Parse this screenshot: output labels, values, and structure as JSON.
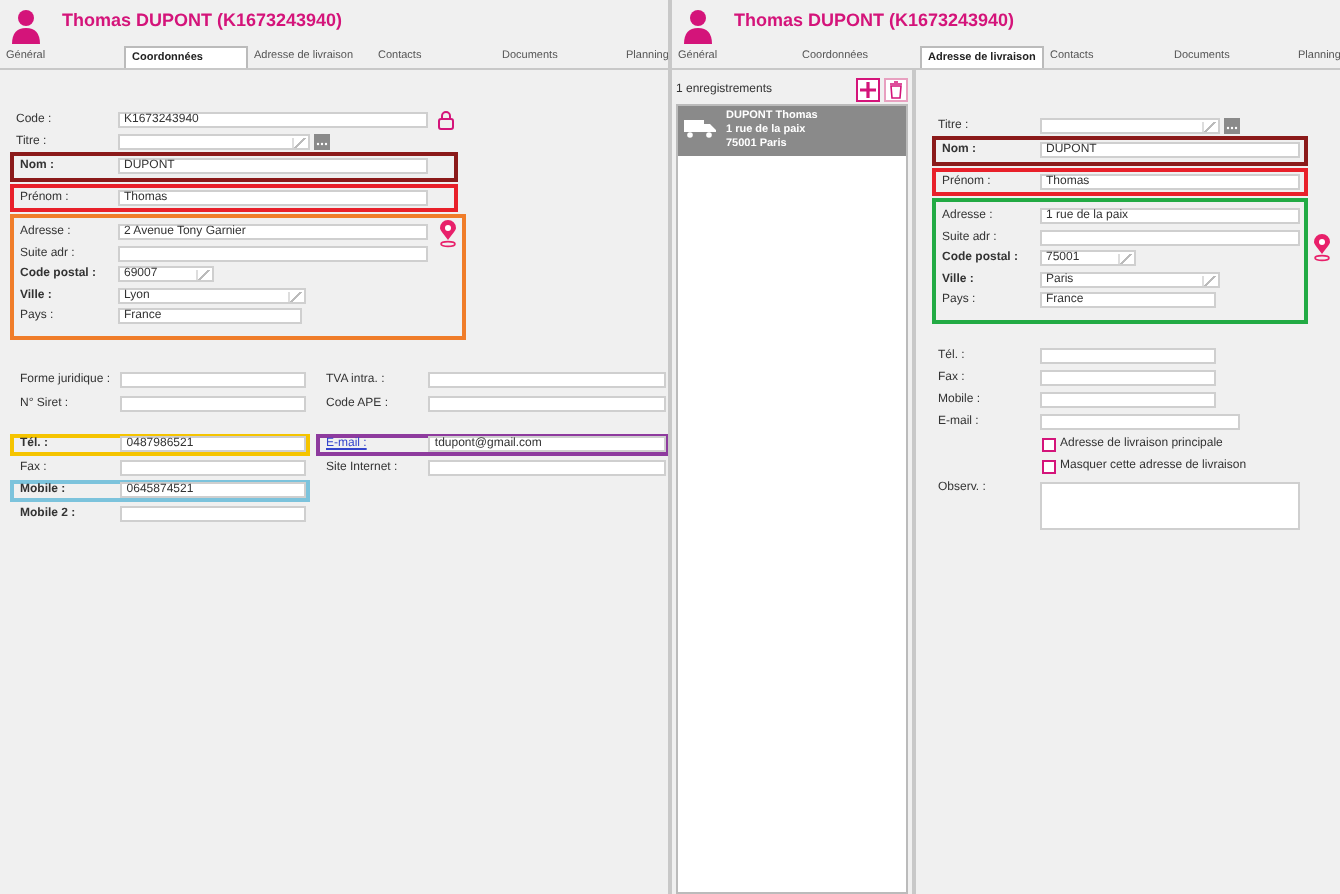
{
  "panels": [
    {
      "title": "Thomas DUPONT (K1673243940)",
      "tabs": [
        {
          "label": "Général",
          "selected": false
        },
        {
          "label": "Coordonnées",
          "selected": true
        },
        {
          "label": "Adresse de livraison",
          "selected": false
        },
        {
          "label": "Contacts",
          "selected": false
        },
        {
          "label": "Documents",
          "selected": false
        },
        {
          "label": "Planning",
          "selected": false
        }
      ],
      "form": [
        {
          "kind": "locked",
          "label": "Code :",
          "value": "K1673243940",
          "bold": false
        },
        {
          "kind": "combomore",
          "label": "Titre :",
          "bold": false
        },
        {
          "kind": "group",
          "color": "#8b1a1a",
          "pin": false,
          "fields": [
            {
              "kind": "input",
              "label": "Nom :",
              "value": "DUPONT",
              "bold": true
            }
          ]
        },
        {
          "kind": "group",
          "color": "#e8202a",
          "pin": false,
          "fields": [
            {
              "kind": "input",
              "label": "Prénom :",
              "value": "Thomas",
              "bold": false
            }
          ]
        },
        {
          "kind": "group",
          "color": "#f07d2a",
          "pin": true,
          "fields": [
            {
              "kind": "input",
              "label": "Adresse :",
              "value": "2 Avenue Tony Garnier",
              "bold": false
            },
            {
              "kind": "input",
              "label": "Suite adr :",
              "bold": false
            },
            {
              "kind": "smallcombo",
              "label": "Code postal :",
              "value": "69007",
              "bold": true
            },
            {
              "kind": "combo",
              "label": "Ville :",
              "value": "Lyon",
              "bold": true
            },
            {
              "kind": "short",
              "label": "Pays :",
              "value": "France",
              "bold": false
            }
          ]
        }
      ],
      "contact_rows": [
        [
          {
            "label": "Forme juridique :",
            "bold": false,
            "link": false
          },
          {
            "label": "TVA intra. :",
            "bold": false,
            "link": false
          }
        ],
        [
          {
            "label": "N° Siret :",
            "bold": false,
            "link": false
          },
          {
            "label": "Code APE :",
            "bold": false,
            "link": false
          }
        ],
        [
          {
            "label": "Tél. :",
            "value": "0487986521",
            "bold": true,
            "link": false,
            "color": "#f5c400"
          },
          {
            "label": "E-mail :",
            "value": "tdupont@gmail.com",
            "bold": false,
            "link": true,
            "color": "#8e3b9e"
          }
        ],
        [
          {
            "label": "Fax :",
            "bold": false,
            "link": false
          },
          {
            "label": "Site Internet :",
            "bold": false,
            "link": false
          }
        ],
        [
          {
            "label": "Mobile :",
            "value": "0645874521",
            "bold": true,
            "link": false,
            "color": "#7cc3dc"
          }
        ],
        [
          {
            "label": "Mobile 2 :",
            "bold": true,
            "link": false
          }
        ]
      ]
    },
    {
      "title": "Thomas DUPONT (K1673243940)",
      "tabs": [
        {
          "label": "Général",
          "selected": false
        },
        {
          "label": "Coordonnées",
          "selected": false
        },
        {
          "label": "Adresse de livraison",
          "selected": true
        },
        {
          "label": "Contacts",
          "selected": false
        },
        {
          "label": "Documents",
          "selected": false
        },
        {
          "label": "Planning",
          "selected": false
        }
      ],
      "records": {
        "count": "1 enregistrements",
        "items": [
          {
            "selected": true,
            "lines": [
              "DUPONT Thomas",
              "1 rue de la paix",
              "75001 Paris"
            ]
          }
        ]
      },
      "form": [
        {
          "kind": "combomore",
          "label": "Titre :",
          "bold": false
        },
        {
          "kind": "group",
          "color": "#8b1a1a",
          "pin": false,
          "fields": [
            {
              "kind": "input",
              "label": "Nom :",
              "value": "DUPONT",
              "bold": true
            }
          ]
        },
        {
          "kind": "group",
          "color": "#e8202a",
          "pin": false,
          "fields": [
            {
              "kind": "input",
              "label": "Prénom :",
              "value": "Thomas",
              "bold": false
            }
          ]
        },
        {
          "kind": "group",
          "color": "#22aa44",
          "pin": true,
          "fields": [
            {
              "kind": "input",
              "label": "Adresse :",
              "value": "1 rue de la paix",
              "bold": false
            },
            {
              "kind": "input",
              "label": "Suite adr :",
              "bold": false
            },
            {
              "kind": "smallcombo",
              "label": "Code postal :",
              "value": "75001",
              "bold": true
            },
            {
              "kind": "combo",
              "label": "Ville :",
              "value": "Paris",
              "bold": true
            },
            {
              "kind": "short",
              "label": "Pays :",
              "value": "France",
              "bold": false
            }
          ]
        },
        {
          "kind": "short",
          "label": "Tél. :",
          "bold": false
        },
        {
          "kind": "short",
          "label": "Fax :",
          "bold": false
        },
        {
          "kind": "short",
          "label": "Mobile :",
          "bold": false
        },
        {
          "kind": "mid",
          "label": "E-mail :",
          "bold": false
        },
        {
          "kind": "check",
          "label": "Adresse de livraison principale",
          "checked": false
        },
        {
          "kind": "check",
          "label": "Masquer cette adresse de livraison",
          "checked": false
        },
        {
          "kind": "area",
          "label": "Observ. :"
        }
      ]
    }
  ]
}
